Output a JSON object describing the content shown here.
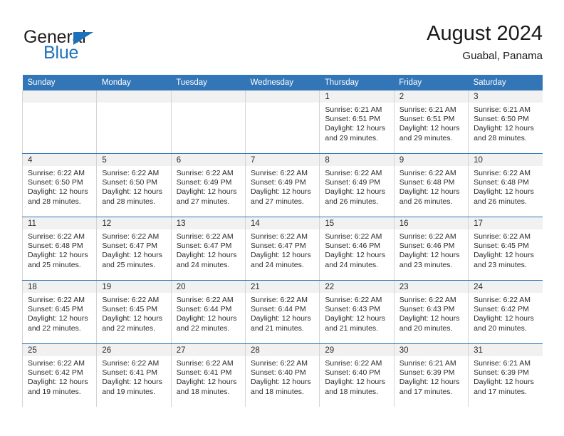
{
  "brand": {
    "name_part1": "General",
    "name_part2": "Blue",
    "triangle_icon": "triangle-icon",
    "color_dark": "#231f20",
    "color_blue": "#1c72ba"
  },
  "header": {
    "title": "August 2024",
    "subtitle": "Guabal, Panama"
  },
  "theme": {
    "header_blue": "#3276b8",
    "daynum_band": "#f1f1f1",
    "text": "#2b2b2b",
    "cell_border": "#d4d4d4"
  },
  "weekday_headers": [
    "Sunday",
    "Monday",
    "Tuesday",
    "Wednesday",
    "Thursday",
    "Friday",
    "Saturday"
  ],
  "weeks": [
    [
      {
        "day": "",
        "sunrise": "",
        "sunset": "",
        "daylight": ""
      },
      {
        "day": "",
        "sunrise": "",
        "sunset": "",
        "daylight": ""
      },
      {
        "day": "",
        "sunrise": "",
        "sunset": "",
        "daylight": ""
      },
      {
        "day": "",
        "sunrise": "",
        "sunset": "",
        "daylight": ""
      },
      {
        "day": "1",
        "sunrise": "Sunrise: 6:21 AM",
        "sunset": "Sunset: 6:51 PM",
        "daylight": "Daylight: 12 hours and 29 minutes."
      },
      {
        "day": "2",
        "sunrise": "Sunrise: 6:21 AM",
        "sunset": "Sunset: 6:51 PM",
        "daylight": "Daylight: 12 hours and 29 minutes."
      },
      {
        "day": "3",
        "sunrise": "Sunrise: 6:21 AM",
        "sunset": "Sunset: 6:50 PM",
        "daylight": "Daylight: 12 hours and 28 minutes."
      }
    ],
    [
      {
        "day": "4",
        "sunrise": "Sunrise: 6:22 AM",
        "sunset": "Sunset: 6:50 PM",
        "daylight": "Daylight: 12 hours and 28 minutes."
      },
      {
        "day": "5",
        "sunrise": "Sunrise: 6:22 AM",
        "sunset": "Sunset: 6:50 PM",
        "daylight": "Daylight: 12 hours and 28 minutes."
      },
      {
        "day": "6",
        "sunrise": "Sunrise: 6:22 AM",
        "sunset": "Sunset: 6:49 PM",
        "daylight": "Daylight: 12 hours and 27 minutes."
      },
      {
        "day": "7",
        "sunrise": "Sunrise: 6:22 AM",
        "sunset": "Sunset: 6:49 PM",
        "daylight": "Daylight: 12 hours and 27 minutes."
      },
      {
        "day": "8",
        "sunrise": "Sunrise: 6:22 AM",
        "sunset": "Sunset: 6:49 PM",
        "daylight": "Daylight: 12 hours and 26 minutes."
      },
      {
        "day": "9",
        "sunrise": "Sunrise: 6:22 AM",
        "sunset": "Sunset: 6:48 PM",
        "daylight": "Daylight: 12 hours and 26 minutes."
      },
      {
        "day": "10",
        "sunrise": "Sunrise: 6:22 AM",
        "sunset": "Sunset: 6:48 PM",
        "daylight": "Daylight: 12 hours and 26 minutes."
      }
    ],
    [
      {
        "day": "11",
        "sunrise": "Sunrise: 6:22 AM",
        "sunset": "Sunset: 6:48 PM",
        "daylight": "Daylight: 12 hours and 25 minutes."
      },
      {
        "day": "12",
        "sunrise": "Sunrise: 6:22 AM",
        "sunset": "Sunset: 6:47 PM",
        "daylight": "Daylight: 12 hours and 25 minutes."
      },
      {
        "day": "13",
        "sunrise": "Sunrise: 6:22 AM",
        "sunset": "Sunset: 6:47 PM",
        "daylight": "Daylight: 12 hours and 24 minutes."
      },
      {
        "day": "14",
        "sunrise": "Sunrise: 6:22 AM",
        "sunset": "Sunset: 6:47 PM",
        "daylight": "Daylight: 12 hours and 24 minutes."
      },
      {
        "day": "15",
        "sunrise": "Sunrise: 6:22 AM",
        "sunset": "Sunset: 6:46 PM",
        "daylight": "Daylight: 12 hours and 24 minutes."
      },
      {
        "day": "16",
        "sunrise": "Sunrise: 6:22 AM",
        "sunset": "Sunset: 6:46 PM",
        "daylight": "Daylight: 12 hours and 23 minutes."
      },
      {
        "day": "17",
        "sunrise": "Sunrise: 6:22 AM",
        "sunset": "Sunset: 6:45 PM",
        "daylight": "Daylight: 12 hours and 23 minutes."
      }
    ],
    [
      {
        "day": "18",
        "sunrise": "Sunrise: 6:22 AM",
        "sunset": "Sunset: 6:45 PM",
        "daylight": "Daylight: 12 hours and 22 minutes."
      },
      {
        "day": "19",
        "sunrise": "Sunrise: 6:22 AM",
        "sunset": "Sunset: 6:45 PM",
        "daylight": "Daylight: 12 hours and 22 minutes."
      },
      {
        "day": "20",
        "sunrise": "Sunrise: 6:22 AM",
        "sunset": "Sunset: 6:44 PM",
        "daylight": "Daylight: 12 hours and 22 minutes."
      },
      {
        "day": "21",
        "sunrise": "Sunrise: 6:22 AM",
        "sunset": "Sunset: 6:44 PM",
        "daylight": "Daylight: 12 hours and 21 minutes."
      },
      {
        "day": "22",
        "sunrise": "Sunrise: 6:22 AM",
        "sunset": "Sunset: 6:43 PM",
        "daylight": "Daylight: 12 hours and 21 minutes."
      },
      {
        "day": "23",
        "sunrise": "Sunrise: 6:22 AM",
        "sunset": "Sunset: 6:43 PM",
        "daylight": "Daylight: 12 hours and 20 minutes."
      },
      {
        "day": "24",
        "sunrise": "Sunrise: 6:22 AM",
        "sunset": "Sunset: 6:42 PM",
        "daylight": "Daylight: 12 hours and 20 minutes."
      }
    ],
    [
      {
        "day": "25",
        "sunrise": "Sunrise: 6:22 AM",
        "sunset": "Sunset: 6:42 PM",
        "daylight": "Daylight: 12 hours and 19 minutes."
      },
      {
        "day": "26",
        "sunrise": "Sunrise: 6:22 AM",
        "sunset": "Sunset: 6:41 PM",
        "daylight": "Daylight: 12 hours and 19 minutes."
      },
      {
        "day": "27",
        "sunrise": "Sunrise: 6:22 AM",
        "sunset": "Sunset: 6:41 PM",
        "daylight": "Daylight: 12 hours and 18 minutes."
      },
      {
        "day": "28",
        "sunrise": "Sunrise: 6:22 AM",
        "sunset": "Sunset: 6:40 PM",
        "daylight": "Daylight: 12 hours and 18 minutes."
      },
      {
        "day": "29",
        "sunrise": "Sunrise: 6:22 AM",
        "sunset": "Sunset: 6:40 PM",
        "daylight": "Daylight: 12 hours and 18 minutes."
      },
      {
        "day": "30",
        "sunrise": "Sunrise: 6:21 AM",
        "sunset": "Sunset: 6:39 PM",
        "daylight": "Daylight: 12 hours and 17 minutes."
      },
      {
        "day": "31",
        "sunrise": "Sunrise: 6:21 AM",
        "sunset": "Sunset: 6:39 PM",
        "daylight": "Daylight: 12 hours and 17 minutes."
      }
    ]
  ]
}
